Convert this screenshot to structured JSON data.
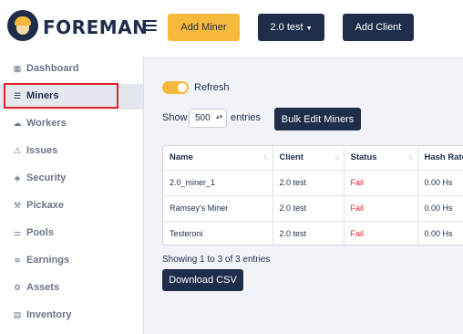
{
  "header": {
    "brand": "FOREMAN",
    "add_miner": "Add Miner",
    "version": "2.0 test",
    "add_client": "Add Client"
  },
  "sidebar": {
    "items": [
      {
        "label": "Dashboard",
        "icon": "dashboard-icon"
      },
      {
        "label": "Miners",
        "icon": "server-icon"
      },
      {
        "label": "Workers",
        "icon": "cloud-icon"
      },
      {
        "label": "Issues",
        "icon": "warning-icon"
      },
      {
        "label": "Security",
        "icon": "shield-icon"
      },
      {
        "label": "Pickaxe",
        "icon": "pickaxe-icon"
      },
      {
        "label": "Pools",
        "icon": "pools-icon"
      },
      {
        "label": "Earnings",
        "icon": "coins-icon"
      },
      {
        "label": "Assets",
        "icon": "chip-icon"
      },
      {
        "label": "Inventory",
        "icon": "inventory-icon"
      }
    ],
    "active": "Miners"
  },
  "main": {
    "refresh_label": "Refresh",
    "show_label": "Show",
    "page_size": "500",
    "entries_label": "entries",
    "bulk_edit": "Bulk Edit Miners",
    "table": {
      "columns": [
        "Name",
        "Client",
        "Status",
        "Hash Rate"
      ],
      "rows": [
        [
          "2.0_miner_1",
          "2.0 test",
          "Fail",
          "0.00 Hs"
        ],
        [
          "Ramsey's Miner",
          "2.0 test",
          "Fail",
          "0.00 Hs"
        ],
        [
          "Testeroni",
          "2.0 test",
          "Fail",
          "0.00 Hs"
        ]
      ]
    },
    "showing": "Showing 1 to 3 of 3 entries",
    "download_csv": "Download CSV"
  },
  "colors": {
    "accent": "#f6b93b",
    "navy": "#1e2d4a",
    "fail": "#e0262c",
    "highlight": "#e0262c"
  }
}
